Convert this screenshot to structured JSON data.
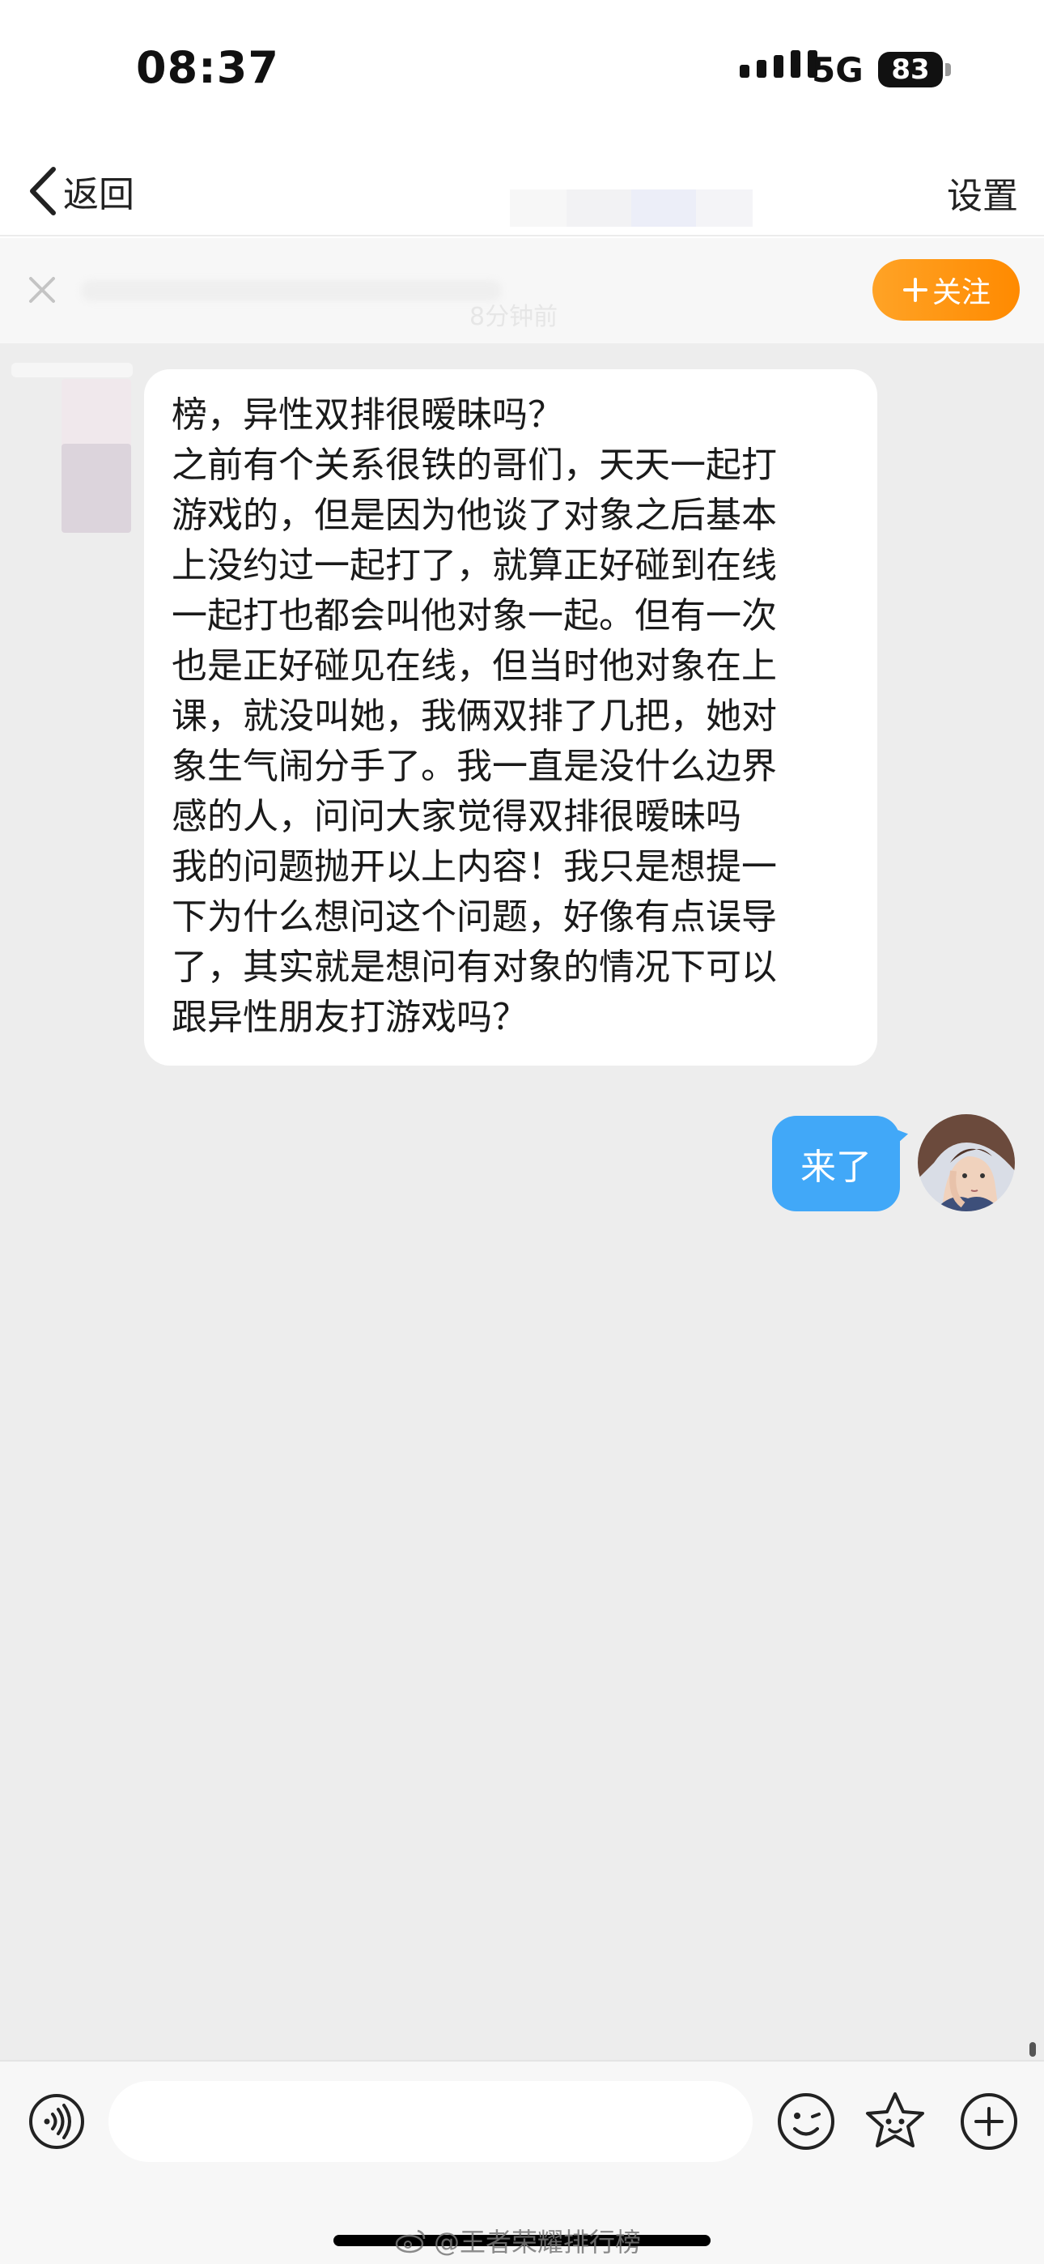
{
  "status_bar": {
    "time": "08:37",
    "network": "5G",
    "battery": "83"
  },
  "nav": {
    "back_label": "返回",
    "settings_label": "设置"
  },
  "banner": {
    "time_text": "8分钟前",
    "follow_label": "关注",
    "follow_color": "#ff8f0a"
  },
  "messages": {
    "peer_lines": [
      "榜，异性双排很暧昧吗？",
      "之前有个关系很铁的哥们，天天一起打",
      "游戏的，但是因为他谈了对象之后基本",
      "上没约过一起打了，就算正好碰到在线",
      "一起打也都会叫他对象一起。但有一次",
      "也是正好碰见在线，但当时他对象在上",
      "课，就没叫她，我俩双排了几把，她对",
      "象生气闹分手了。我一直是没什么边界",
      "感的人，问问大家觉得双排很暧昧吗",
      "我的问题抛开以上内容！我只是想提一",
      "下为什么想问这个问题，好像有点误导",
      "了，其实就是想问有对象的情况下可以",
      "跟异性朋友打游戏吗？"
    ],
    "my_message": "来了",
    "my_bubble_color": "#41a8f8"
  },
  "input_bar": {
    "placeholder": ""
  },
  "watermark": "@王者荣耀排行榜",
  "icons": [
    "back-chevron-icon",
    "close-icon",
    "plus-icon",
    "voice-icon",
    "emoji-icon",
    "sticker-icon",
    "add-icon",
    "weibo-icon"
  ]
}
